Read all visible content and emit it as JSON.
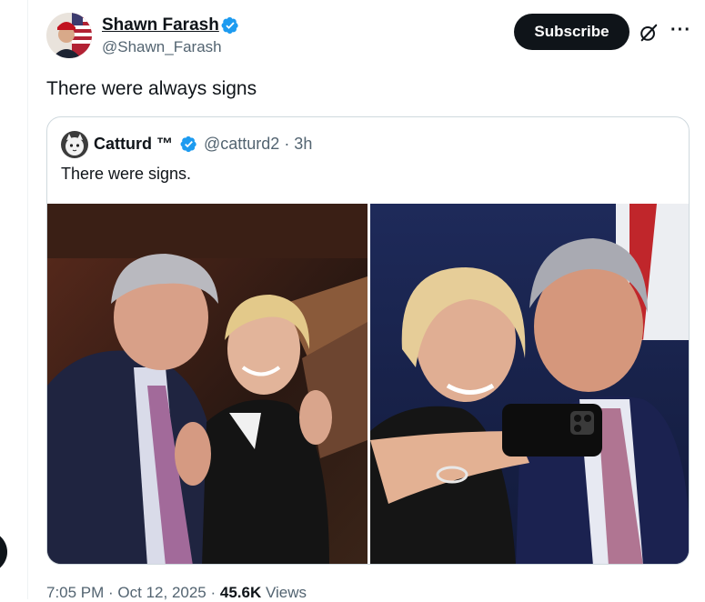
{
  "post": {
    "author_name": "Shawn Farash",
    "author_handle": "@Shawn_Farash",
    "text": "There were always signs",
    "subscribe_label": "Subscribe",
    "more_label": "···",
    "timestamp": "7:05 PM · Oct 12, 2025 · ",
    "views_count": "45.6K",
    "views_label": " Views"
  },
  "quote": {
    "author_name": "Catturd ™",
    "author_meta": "@catturd2 · 3h",
    "text": "There were signs."
  },
  "colors": {
    "verified_blue": "#1d9bf0",
    "text_primary": "#0f1419",
    "text_secondary": "#536471",
    "border": "#cfd9de"
  },
  "icons": [
    "verified-badge-icon",
    "grok-icon",
    "more-icon"
  ]
}
